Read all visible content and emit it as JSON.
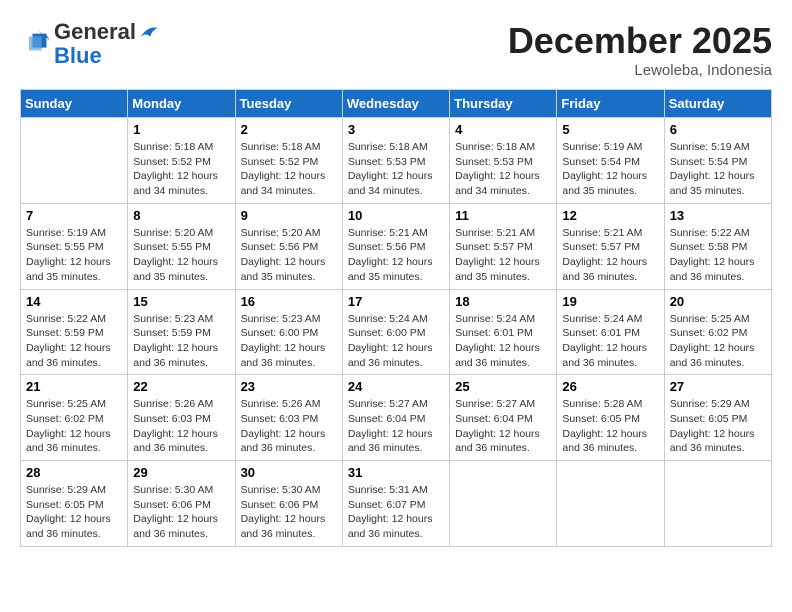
{
  "header": {
    "logo_line1": "General",
    "logo_line2": "Blue",
    "month_title": "December 2025",
    "location": "Lewoleba, Indonesia"
  },
  "weekdays": [
    "Sunday",
    "Monday",
    "Tuesday",
    "Wednesday",
    "Thursday",
    "Friday",
    "Saturday"
  ],
  "weeks": [
    [
      {
        "day": "",
        "info": ""
      },
      {
        "day": "1",
        "info": "Sunrise: 5:18 AM\nSunset: 5:52 PM\nDaylight: 12 hours\nand 34 minutes."
      },
      {
        "day": "2",
        "info": "Sunrise: 5:18 AM\nSunset: 5:52 PM\nDaylight: 12 hours\nand 34 minutes."
      },
      {
        "day": "3",
        "info": "Sunrise: 5:18 AM\nSunset: 5:53 PM\nDaylight: 12 hours\nand 34 minutes."
      },
      {
        "day": "4",
        "info": "Sunrise: 5:18 AM\nSunset: 5:53 PM\nDaylight: 12 hours\nand 34 minutes."
      },
      {
        "day": "5",
        "info": "Sunrise: 5:19 AM\nSunset: 5:54 PM\nDaylight: 12 hours\nand 35 minutes."
      },
      {
        "day": "6",
        "info": "Sunrise: 5:19 AM\nSunset: 5:54 PM\nDaylight: 12 hours\nand 35 minutes."
      }
    ],
    [
      {
        "day": "7",
        "info": "Sunrise: 5:19 AM\nSunset: 5:55 PM\nDaylight: 12 hours\nand 35 minutes."
      },
      {
        "day": "8",
        "info": "Sunrise: 5:20 AM\nSunset: 5:55 PM\nDaylight: 12 hours\nand 35 minutes."
      },
      {
        "day": "9",
        "info": "Sunrise: 5:20 AM\nSunset: 5:56 PM\nDaylight: 12 hours\nand 35 minutes."
      },
      {
        "day": "10",
        "info": "Sunrise: 5:21 AM\nSunset: 5:56 PM\nDaylight: 12 hours\nand 35 minutes."
      },
      {
        "day": "11",
        "info": "Sunrise: 5:21 AM\nSunset: 5:57 PM\nDaylight: 12 hours\nand 35 minutes."
      },
      {
        "day": "12",
        "info": "Sunrise: 5:21 AM\nSunset: 5:57 PM\nDaylight: 12 hours\nand 36 minutes."
      },
      {
        "day": "13",
        "info": "Sunrise: 5:22 AM\nSunset: 5:58 PM\nDaylight: 12 hours\nand 36 minutes."
      }
    ],
    [
      {
        "day": "14",
        "info": "Sunrise: 5:22 AM\nSunset: 5:59 PM\nDaylight: 12 hours\nand 36 minutes."
      },
      {
        "day": "15",
        "info": "Sunrise: 5:23 AM\nSunset: 5:59 PM\nDaylight: 12 hours\nand 36 minutes."
      },
      {
        "day": "16",
        "info": "Sunrise: 5:23 AM\nSunset: 6:00 PM\nDaylight: 12 hours\nand 36 minutes."
      },
      {
        "day": "17",
        "info": "Sunrise: 5:24 AM\nSunset: 6:00 PM\nDaylight: 12 hours\nand 36 minutes."
      },
      {
        "day": "18",
        "info": "Sunrise: 5:24 AM\nSunset: 6:01 PM\nDaylight: 12 hours\nand 36 minutes."
      },
      {
        "day": "19",
        "info": "Sunrise: 5:24 AM\nSunset: 6:01 PM\nDaylight: 12 hours\nand 36 minutes."
      },
      {
        "day": "20",
        "info": "Sunrise: 5:25 AM\nSunset: 6:02 PM\nDaylight: 12 hours\nand 36 minutes."
      }
    ],
    [
      {
        "day": "21",
        "info": "Sunrise: 5:25 AM\nSunset: 6:02 PM\nDaylight: 12 hours\nand 36 minutes."
      },
      {
        "day": "22",
        "info": "Sunrise: 5:26 AM\nSunset: 6:03 PM\nDaylight: 12 hours\nand 36 minutes."
      },
      {
        "day": "23",
        "info": "Sunrise: 5:26 AM\nSunset: 6:03 PM\nDaylight: 12 hours\nand 36 minutes."
      },
      {
        "day": "24",
        "info": "Sunrise: 5:27 AM\nSunset: 6:04 PM\nDaylight: 12 hours\nand 36 minutes."
      },
      {
        "day": "25",
        "info": "Sunrise: 5:27 AM\nSunset: 6:04 PM\nDaylight: 12 hours\nand 36 minutes."
      },
      {
        "day": "26",
        "info": "Sunrise: 5:28 AM\nSunset: 6:05 PM\nDaylight: 12 hours\nand 36 minutes."
      },
      {
        "day": "27",
        "info": "Sunrise: 5:29 AM\nSunset: 6:05 PM\nDaylight: 12 hours\nand 36 minutes."
      }
    ],
    [
      {
        "day": "28",
        "info": "Sunrise: 5:29 AM\nSunset: 6:05 PM\nDaylight: 12 hours\nand 36 minutes."
      },
      {
        "day": "29",
        "info": "Sunrise: 5:30 AM\nSunset: 6:06 PM\nDaylight: 12 hours\nand 36 minutes."
      },
      {
        "day": "30",
        "info": "Sunrise: 5:30 AM\nSunset: 6:06 PM\nDaylight: 12 hours\nand 36 minutes."
      },
      {
        "day": "31",
        "info": "Sunrise: 5:31 AM\nSunset: 6:07 PM\nDaylight: 12 hours\nand 36 minutes."
      },
      {
        "day": "",
        "info": ""
      },
      {
        "day": "",
        "info": ""
      },
      {
        "day": "",
        "info": ""
      }
    ]
  ]
}
